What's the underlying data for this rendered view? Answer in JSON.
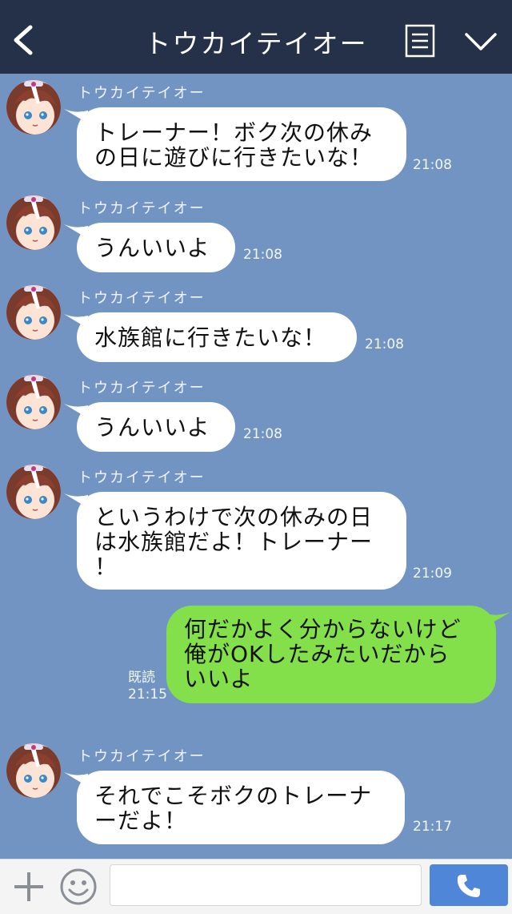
{
  "header": {
    "title": "トウカイテイオー",
    "back_icon": "back-arrow-icon",
    "menu_icon": "list-icon",
    "expand_icon": "chevron-down-icon"
  },
  "messages": [
    {
      "sender": "トウカイテイオー",
      "text": "トレーナー！ボク次の休み\nの日に遊びに行きたいな！",
      "time": "21:08"
    },
    {
      "sender": "トウカイテイオー",
      "text": "うんいいよ",
      "time": "21:08"
    },
    {
      "sender": "トウカイテイオー",
      "text": "水族館に行きたいな！",
      "time": "21:08"
    },
    {
      "sender": "トウカイテイオー",
      "text": "うんいいよ",
      "time": "21:08"
    },
    {
      "sender": "トウカイテイオー",
      "text": "というわけで次の休みの日\nは水族館だよ！トレーナー\n！",
      "time": "21:09"
    },
    {
      "sender": "トウカイテイオー",
      "text": "それでこそボクのトレーナ\nーだよ！",
      "time": "21:17"
    }
  ],
  "my_message": {
    "text": "何だかよく分からないけど\n俺がOKしたみたいだから\nいいよ",
    "read_label": "既読",
    "time": "21:15"
  },
  "footer": {
    "input_placeholder": "",
    "plus_icon": "plus-icon",
    "emoji_icon": "smiley-icon",
    "call_icon": "phone-icon"
  },
  "colors": {
    "header_bg": "#243148",
    "chat_bg": "#7194c3",
    "my_bubble": "#84e04a",
    "their_bubble": "#ffffff",
    "call_button": "#4f86d8"
  }
}
